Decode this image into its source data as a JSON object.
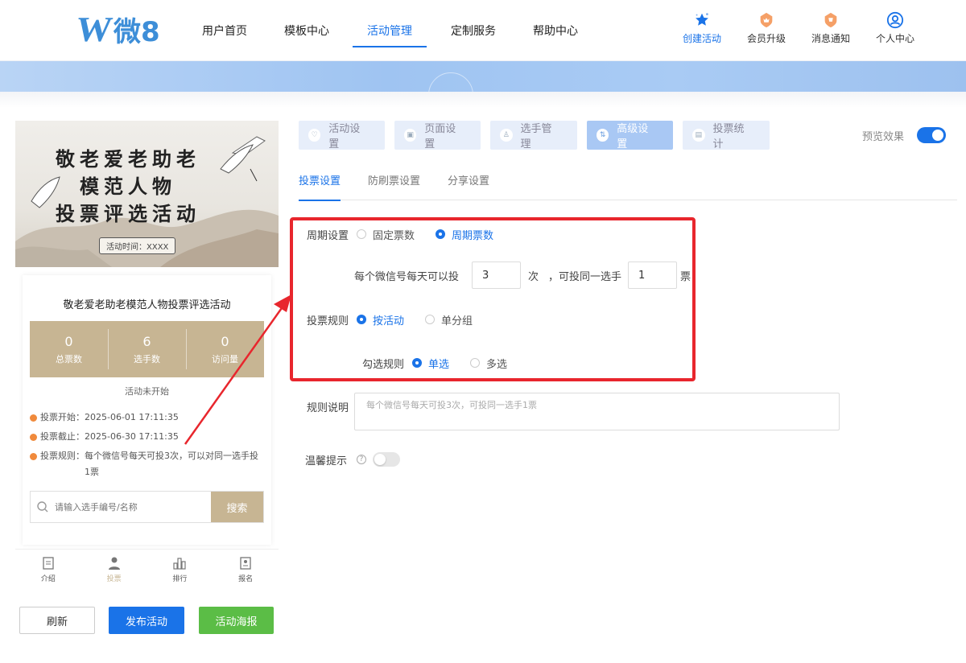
{
  "header": {
    "logo": {
      "mark": "W",
      "text": "微8"
    },
    "nav": [
      {
        "label": "用户首页",
        "active": false
      },
      {
        "label": "模板中心",
        "active": false
      },
      {
        "label": "活动管理",
        "active": true
      },
      {
        "label": "定制服务",
        "active": false
      },
      {
        "label": "帮助中心",
        "active": false
      }
    ],
    "right": [
      {
        "label": "创建活动",
        "icon": "star-icon"
      },
      {
        "label": "会员升级",
        "icon": "crown-badge-icon"
      },
      {
        "label": "消息通知",
        "icon": "bell-badge-icon"
      },
      {
        "label": "个人中心",
        "icon": "user-icon"
      }
    ]
  },
  "preview": {
    "poster": {
      "line1": "敬老爱老助老",
      "line2": "模范人物",
      "line3": "投票评选活动",
      "time": "活动时间：XXXX"
    },
    "title": "敬老爱老助老模范人物投票评选活动",
    "stats": [
      {
        "value": "0",
        "label": "总票数"
      },
      {
        "value": "6",
        "label": "选手数"
      },
      {
        "value": "0",
        "label": "访问量"
      }
    ],
    "status": "活动未开始",
    "info": [
      {
        "label": "投票开始：",
        "value": "2025-06-01 17:11:35"
      },
      {
        "label": "投票截止：",
        "value": "2025-06-30 17:11:35"
      },
      {
        "label": "投票规则：",
        "value": "每个微信号每天可投3次，可以对同一选手投1票"
      }
    ],
    "search": {
      "placeholder": "请输入选手编号/名称",
      "button": "搜索"
    },
    "tabbar": [
      {
        "label": "介绍",
        "icon": "doc-icon"
      },
      {
        "label": "投票",
        "icon": "person-icon"
      },
      {
        "label": "排行",
        "icon": "bar-icon"
      },
      {
        "label": "报名",
        "icon": "form-icon"
      }
    ]
  },
  "actions": {
    "refresh": "刷新",
    "publish": "发布活动",
    "poster": "活动海报"
  },
  "settings": {
    "tabs": [
      {
        "label": "活动设置",
        "icon": "♡"
      },
      {
        "label": "页面设置",
        "icon": "▣"
      },
      {
        "label": "选手管理",
        "icon": "♙"
      },
      {
        "label": "高级设置",
        "icon": "⇅"
      },
      {
        "label": "投票统计",
        "icon": "▤"
      }
    ],
    "preview_label": "预览效果",
    "subtabs": [
      "投票设置",
      "防刷票设置",
      "分享设置"
    ],
    "cycle": {
      "label": "周期设置",
      "opt1": "固定票数",
      "opt2": "周期票数"
    },
    "perday": {
      "prefix": "每个微信号每天可以投",
      "times": "3",
      "unit1": "次",
      "mid": "，可投同一选手",
      "votes": "1",
      "unit2": "票"
    },
    "rule": {
      "label": "投票规则",
      "opt1": "按活动",
      "opt2": "单分组"
    },
    "select": {
      "label": "勾选规则",
      "opt1": "单选",
      "opt2": "多选"
    },
    "desc": {
      "label": "规则说明",
      "placeholder": "每个微信号每天可投3次，可投同一选手1票"
    },
    "tip": {
      "label": "温馨提示"
    }
  }
}
